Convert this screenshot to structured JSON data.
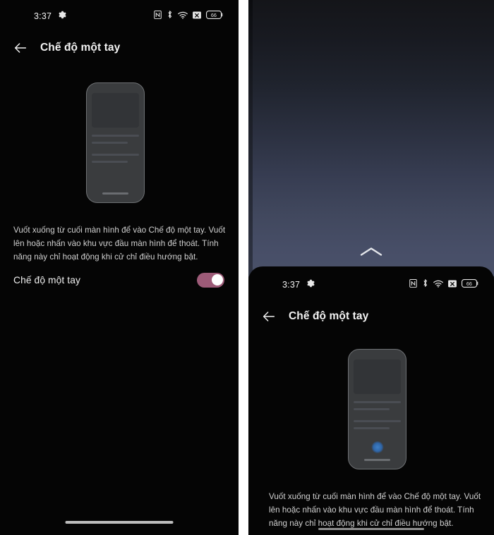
{
  "screen": {
    "status_bar": {
      "time": "3:37",
      "icons": [
        "gear-icon",
        "nfc-icon",
        "bluetooth-icon",
        "wifi-icon",
        "no-sim-icon",
        "battery-icon"
      ],
      "battery_level": "66"
    },
    "app_bar": {
      "back_icon": "back-arrow-icon",
      "title": "Chế độ một tay"
    },
    "description": "Vuốt xuống từ cuối màn hình để vào Chế độ một tay. Vuốt lên hoặc nhấn vào khu vực đầu màn hình để thoát. Tính năng này chỉ hoạt động khi cử chỉ điều hướng bật.",
    "setting_row": {
      "label": "Chế độ một tay",
      "toggle_state": "on",
      "toggle_color": "#9d5b78"
    }
  },
  "right_panel": {
    "wallpaper_gradient_top": "#141519",
    "wallpaper_gradient_bottom": "#4a5169",
    "exit_hint_icon": "chevron-up-icon",
    "touch_indicator_icon": "touch-dot-icon",
    "touch_indicator_color": "#3f7fc4"
  },
  "illustration": {
    "name": "phone-illustration",
    "border_color": "#6e7174",
    "body_color": "#3a3c3e"
  }
}
